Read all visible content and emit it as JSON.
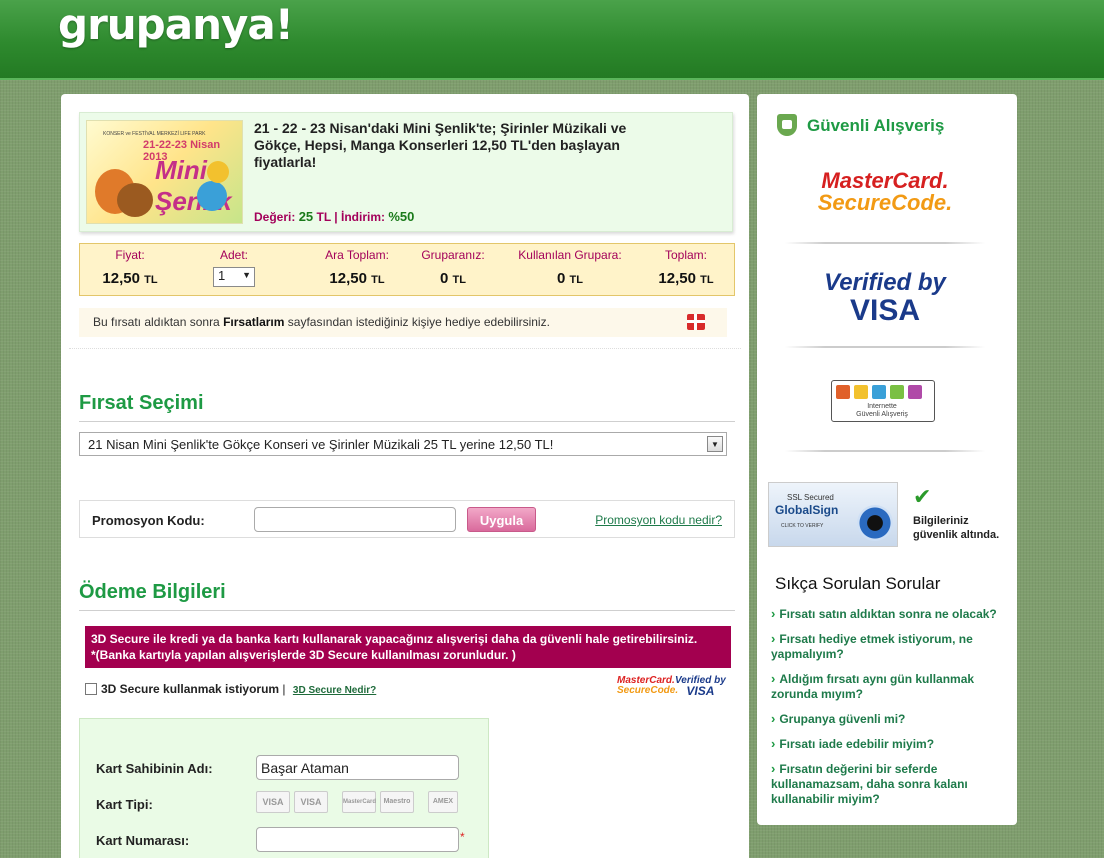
{
  "header": {
    "logo": "grupanya!"
  },
  "deal": {
    "image_texts": {
      "small": "KONSER ve FESTİVAL MERKEZİ LIFE PARK",
      "dates": "21-22-23 Nisan 2013",
      "brand": "Mini Şenlik"
    },
    "title": "21 - 22 - 23 Nisan'daki Mini Şenlik'te; Şirinler Müzikali ve Gökçe, Hepsi, Manga Konserleri 12,50 TL'den başlayan fiyatlarla!",
    "value_label": "Değeri:",
    "value": "25",
    "value_unit": "TL",
    "separator": "|",
    "discount_label": "İndirim:",
    "discount": "%50"
  },
  "price_table": {
    "columns": [
      {
        "label": "Fiyat:",
        "value": "12,50",
        "unit": "TL"
      },
      {
        "label": "Adet:",
        "value": "1",
        "unit": ""
      },
      {
        "label": "Ara Toplam:",
        "value": "12,50",
        "unit": "TL"
      },
      {
        "label": "Gruparanız:",
        "value": "0",
        "unit": "TL"
      },
      {
        "label": "Kullanılan Grupara:",
        "value": "0",
        "unit": "TL"
      },
      {
        "label": "Toplam:",
        "value": "12,50",
        "unit": "TL"
      }
    ]
  },
  "gift": {
    "text_before": "Bu fırsatı aldıktan sonra ",
    "bold": "Fırsatlarım",
    "text_after": " sayfasından istediğiniz kişiye hediye edebilirsiniz."
  },
  "firsat": {
    "title": "Fırsat Seçimi",
    "selected": "21 Nisan Mini Şenlik'te Gökçe Konseri ve Şirinler Müzikali 25 TL yerine 12,50 TL!"
  },
  "promo": {
    "label": "Promosyon Kodu:",
    "value": "",
    "button": "Uygula",
    "link": "Promosyon kodu nedir?"
  },
  "odeme": {
    "title": "Ödeme Bilgileri",
    "notice_line1": "3D Secure ile kredi ya da banka kartı kullanarak yapacağınız alışverişi daha da güvenli hale getirebilirsiniz.",
    "notice_line2": "*(Banka kartıyla yapılan alışverişlerde 3D Secure kullanılması zorunludur. )",
    "checkbox_label": "3D Secure kullanmak istiyorum",
    "checkbox_sep": "|",
    "checkbox_link": "3D Secure Nedir?",
    "mini_mastercard": [
      "MasterCard.",
      "SecureCode."
    ],
    "mini_visa": [
      "Verified by",
      "VISA"
    ]
  },
  "card": {
    "holder_label": "Kart Sahibinin Adı:",
    "holder_value": "Başar Ataman",
    "type_label": "Kart Tipi:",
    "types": [
      "VISA",
      "VISA",
      "MasterCard",
      "Maestro",
      "AMEX"
    ],
    "number_label": "Kart Numarası:",
    "number_value": "",
    "required": "*"
  },
  "sidebar": {
    "title": "Güvenli Alışveriş",
    "mastercard": [
      "MasterCard.",
      "SecureCode."
    ],
    "visa": [
      "Verified by",
      "VISA"
    ],
    "internet_seal": [
      "Internette",
      "Güvenli Alışveriş"
    ],
    "globalsign": [
      "SSL Secured",
      "GlobalSign",
      "CLICK TO VERIFY"
    ],
    "security_text": "Bilgileriniz güvenlik altında."
  },
  "faq": {
    "title": "Sıkça Sorulan Sorular",
    "items": [
      "Fırsatı satın aldıktan sonra ne olacak?",
      "Fırsatı hediye etmek istiyorum, ne yapmalıyım?",
      "Aldığım fırsatı aynı gün kullanmak zorunda mıyım?",
      "Grupanya güvenli mi?",
      "Fırsatı iade edebilir miyim?",
      "Fırsatın değerini bir seferde kullanamazsam, daha sonra kalanı kullanabilir miyim?"
    ]
  },
  "colors": {
    "brand_green": "#1e9a44",
    "accent_magenta": "#a3005a",
    "header_green": "#2e8a2e"
  }
}
